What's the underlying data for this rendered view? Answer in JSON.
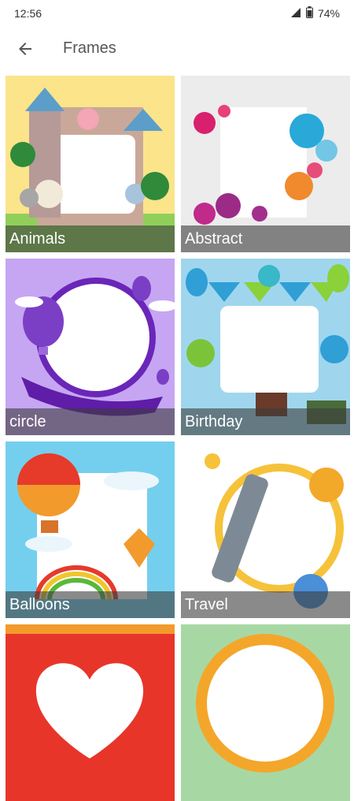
{
  "status_bar": {
    "time": "12:56",
    "battery": "74%"
  },
  "header": {
    "title": "Frames"
  },
  "frames": [
    {
      "label": "Animals"
    },
    {
      "label": "Abstract"
    },
    {
      "label": "circle"
    },
    {
      "label": "Birthday"
    },
    {
      "label": "Balloons"
    },
    {
      "label": "Travel"
    },
    {
      "label": ""
    },
    {
      "label": ""
    }
  ]
}
